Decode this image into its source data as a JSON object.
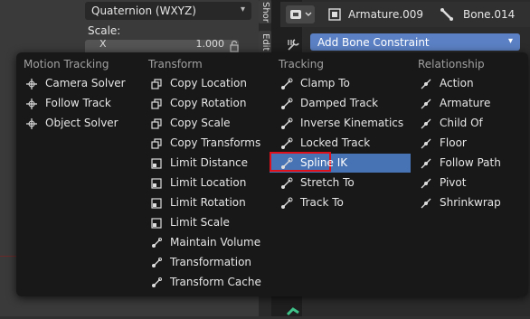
{
  "left_panel": {
    "rotation_mode": "Quaternion (WXYZ)",
    "scale_label": "Scale:",
    "scale_x_axis": "X",
    "scale_x_value": "1.000"
  },
  "vertical_tabs": [
    "Shor",
    "Edit"
  ],
  "header": {
    "armature": "Armature.009",
    "bone": "Bone.014",
    "add_constraint_label": "Add Bone Constraint"
  },
  "menu": {
    "columns": [
      {
        "heading": "Motion Tracking",
        "items": [
          {
            "label": "Camera Solver",
            "icon": "camera-solver-icon"
          },
          {
            "label": "Follow Track",
            "icon": "follow-track-icon"
          },
          {
            "label": "Object Solver",
            "icon": "object-solver-icon"
          }
        ]
      },
      {
        "heading": "Transform",
        "items": [
          {
            "label": "Copy Location",
            "icon": "copy-location-icon"
          },
          {
            "label": "Copy Rotation",
            "icon": "copy-rotation-icon"
          },
          {
            "label": "Copy Scale",
            "icon": "copy-scale-icon"
          },
          {
            "label": "Copy Transforms",
            "icon": "copy-transforms-icon"
          },
          {
            "label": "Limit Distance",
            "icon": "limit-distance-icon"
          },
          {
            "label": "Limit Location",
            "icon": "limit-location-icon"
          },
          {
            "label": "Limit Rotation",
            "icon": "limit-rotation-icon"
          },
          {
            "label": "Limit Scale",
            "icon": "limit-scale-icon"
          },
          {
            "label": "Maintain Volume",
            "icon": "maintain-volume-icon"
          },
          {
            "label": "Transformation",
            "icon": "transformation-icon"
          },
          {
            "label": "Transform Cache",
            "icon": "transform-cache-icon"
          }
        ]
      },
      {
        "heading": "Tracking",
        "items": [
          {
            "label": "Clamp To",
            "icon": "clamp-to-icon"
          },
          {
            "label": "Damped Track",
            "icon": "damped-track-icon"
          },
          {
            "label": "Inverse Kinematics",
            "icon": "inverse-kinematics-icon"
          },
          {
            "label": "Locked Track",
            "icon": "locked-track-icon"
          },
          {
            "label": "Spline IK",
            "icon": "spline-ik-icon"
          },
          {
            "label": "Stretch To",
            "icon": "stretch-to-icon"
          },
          {
            "label": "Track To",
            "icon": "track-to-icon"
          }
        ]
      },
      {
        "heading": "Relationship",
        "items": [
          {
            "label": "Action",
            "icon": "action-icon"
          },
          {
            "label": "Armature",
            "icon": "armature-icon"
          },
          {
            "label": "Child Of",
            "icon": "child-of-icon"
          },
          {
            "label": "Floor",
            "icon": "floor-icon"
          },
          {
            "label": "Follow Path",
            "icon": "follow-path-icon"
          },
          {
            "label": "Pivot",
            "icon": "pivot-icon"
          },
          {
            "label": "Shrinkwrap",
            "icon": "shrinkwrap-icon"
          }
        ]
      }
    ],
    "highlighted_item": "Spline IK"
  },
  "colors": {
    "menu_bg": "#181818",
    "highlight": "#4772b3",
    "add_button": "#5b80c3",
    "annotation_box": "#e0101a"
  }
}
